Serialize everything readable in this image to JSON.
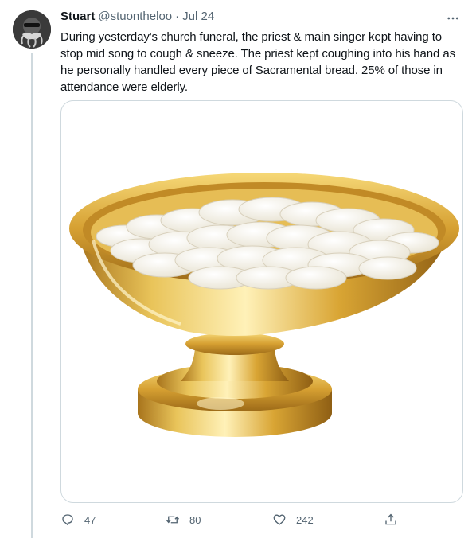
{
  "tweet": {
    "author_name": "Stuart",
    "author_handle": "@stuontheloo",
    "separator": "·",
    "date": "Jul 24",
    "text": "During yesterday's church funeral, the priest & main singer kept having to stop mid song to cough & sneeze. The priest kept coughing into his hand as he personally handled every piece of Sacramental bread. 25% of those in attendance were elderly.",
    "more_icon": "more-horizontal-icon",
    "media": {
      "subject": "gold-bowl-with-communion-wafers-image"
    },
    "stats": {
      "replies": "47",
      "retweets": "80",
      "likes": "242"
    }
  },
  "colors": {
    "text_primary": "#0f1419",
    "text_secondary": "#536471",
    "border": "#cfd9de",
    "gold": "#d9a82f"
  }
}
